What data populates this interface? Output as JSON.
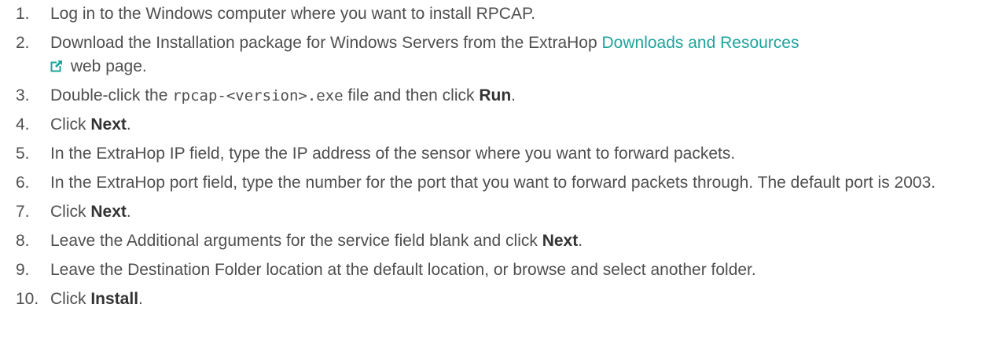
{
  "steps": [
    {
      "num": "1.",
      "text": "Log in to the Windows computer where you want to install RPCAP."
    },
    {
      "num": "2.",
      "text_before": "Download the Installation package for Windows Servers from the ExtraHop ",
      "link_text": "Downloads and Resources",
      "text_after": " web page.",
      "link_icon": "external-link-icon"
    },
    {
      "num": "3.",
      "text_before": "Double-click the ",
      "code": "rpcap-<version>.exe",
      "text_mid": " file and then click ",
      "bold": "Run",
      "text_after": "."
    },
    {
      "num": "4.",
      "text_before": "Click ",
      "bold": "Next",
      "text_after": "."
    },
    {
      "num": "5.",
      "text": "In the ExtraHop IP field, type the IP address of the sensor where you want to forward packets."
    },
    {
      "num": "6.",
      "text": "In the ExtraHop port field, type the number for the port that you want to forward packets through. The default port is 2003."
    },
    {
      "num": "7.",
      "text_before": "Click ",
      "bold": "Next",
      "text_after": "."
    },
    {
      "num": "8.",
      "text_before": "Leave the Additional arguments for the service field blank and click ",
      "bold": "Next",
      "text_after": "."
    },
    {
      "num": "9.",
      "text": "Leave the Destination Folder location at the default location, or browse and select another folder."
    },
    {
      "num": "10.",
      "text_before": "Click ",
      "bold": "Install",
      "text_after": "."
    }
  ],
  "colors": {
    "text": "#4f4f4f",
    "link": "#1fa39b"
  }
}
